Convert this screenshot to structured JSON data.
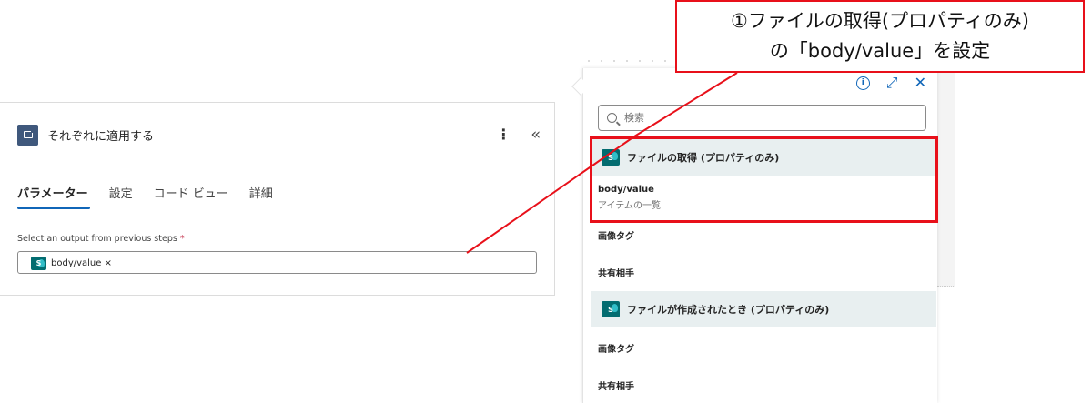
{
  "action_card": {
    "title": "それぞれに適用する",
    "tabs": [
      "パラメーター",
      "設定",
      "コード ビュー",
      "詳細"
    ],
    "active_tab_index": 0,
    "field_label": "Select an output from previous steps",
    "required_mark": "*",
    "token_label": "body/value ×",
    "token_icon": "S"
  },
  "flyout": {
    "search_placeholder": "検索",
    "groups": [
      {
        "title": "ファイルの取得 (プロパティのみ)",
        "icon": "S",
        "items": [
          {
            "name": "body/value",
            "desc": "アイテムの一覧"
          },
          {
            "name": "画像タグ",
            "desc": ""
          },
          {
            "name": "共有相手",
            "desc": ""
          }
        ]
      },
      {
        "title": "ファイルが作成されたとき (プロパティのみ)",
        "icon": "S",
        "items": [
          {
            "name": "画像タグ",
            "desc": ""
          },
          {
            "name": "共有相手",
            "desc": ""
          }
        ]
      }
    ]
  },
  "annotation": {
    "line1": "①ファイルの取得(プロパティのみ)",
    "line2": "の「body/value」を設定"
  },
  "colors": {
    "accent": "#1066b8",
    "annotation_red": "#e8101a",
    "sharepoint": "#036c70",
    "action_icon": "#3f587c"
  }
}
